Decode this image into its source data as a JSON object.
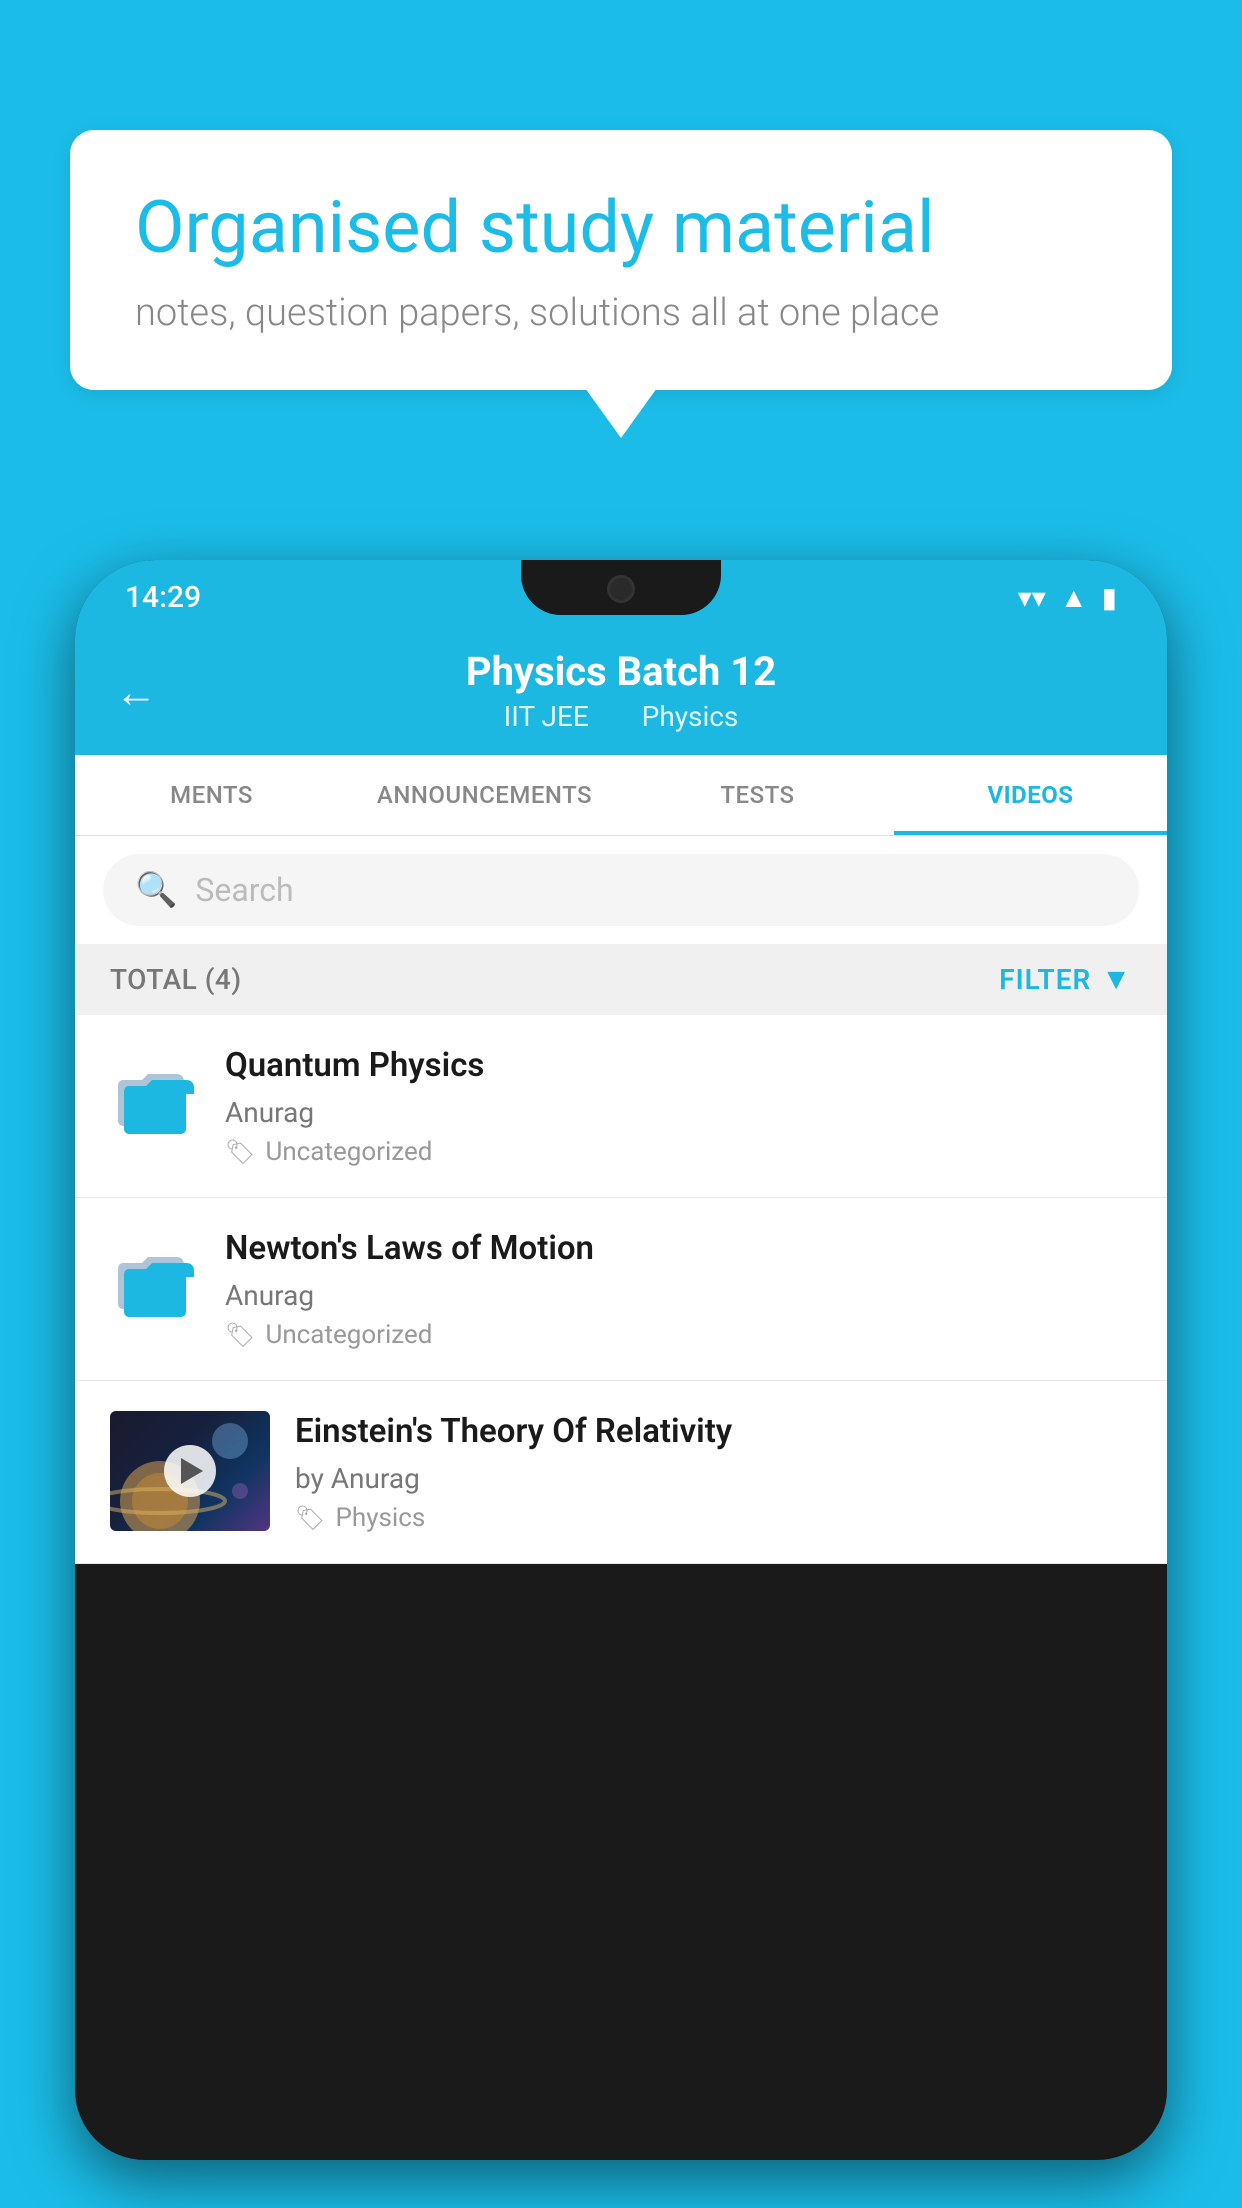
{
  "background_color": "#1bbde8",
  "speech_bubble": {
    "title": "Organised study material",
    "subtitle": "notes, question papers, solutions all at one place"
  },
  "phone": {
    "status_bar": {
      "time": "14:29",
      "wifi": "▼",
      "signal": "▲",
      "battery": "▮"
    },
    "header": {
      "back_label": "←",
      "title": "Physics Batch 12",
      "subtitle_left": "IIT JEE",
      "subtitle_right": "Physics"
    },
    "tabs": [
      {
        "label": "MENTS",
        "active": false
      },
      {
        "label": "ANNOUNCEMENTS",
        "active": false
      },
      {
        "label": "TESTS",
        "active": false
      },
      {
        "label": "VIDEOS",
        "active": true
      }
    ],
    "search": {
      "placeholder": "Search"
    },
    "filter_bar": {
      "total_label": "TOTAL (4)",
      "filter_label": "FILTER"
    },
    "videos": [
      {
        "id": 1,
        "title": "Quantum Physics",
        "author": "Anurag",
        "tag": "Uncategorized",
        "has_thumbnail": false
      },
      {
        "id": 2,
        "title": "Newton's Laws of Motion",
        "author": "Anurag",
        "tag": "Uncategorized",
        "has_thumbnail": false
      },
      {
        "id": 3,
        "title": "Einstein's Theory Of Relativity",
        "author": "by Anurag",
        "tag": "Physics",
        "has_thumbnail": true
      }
    ]
  }
}
